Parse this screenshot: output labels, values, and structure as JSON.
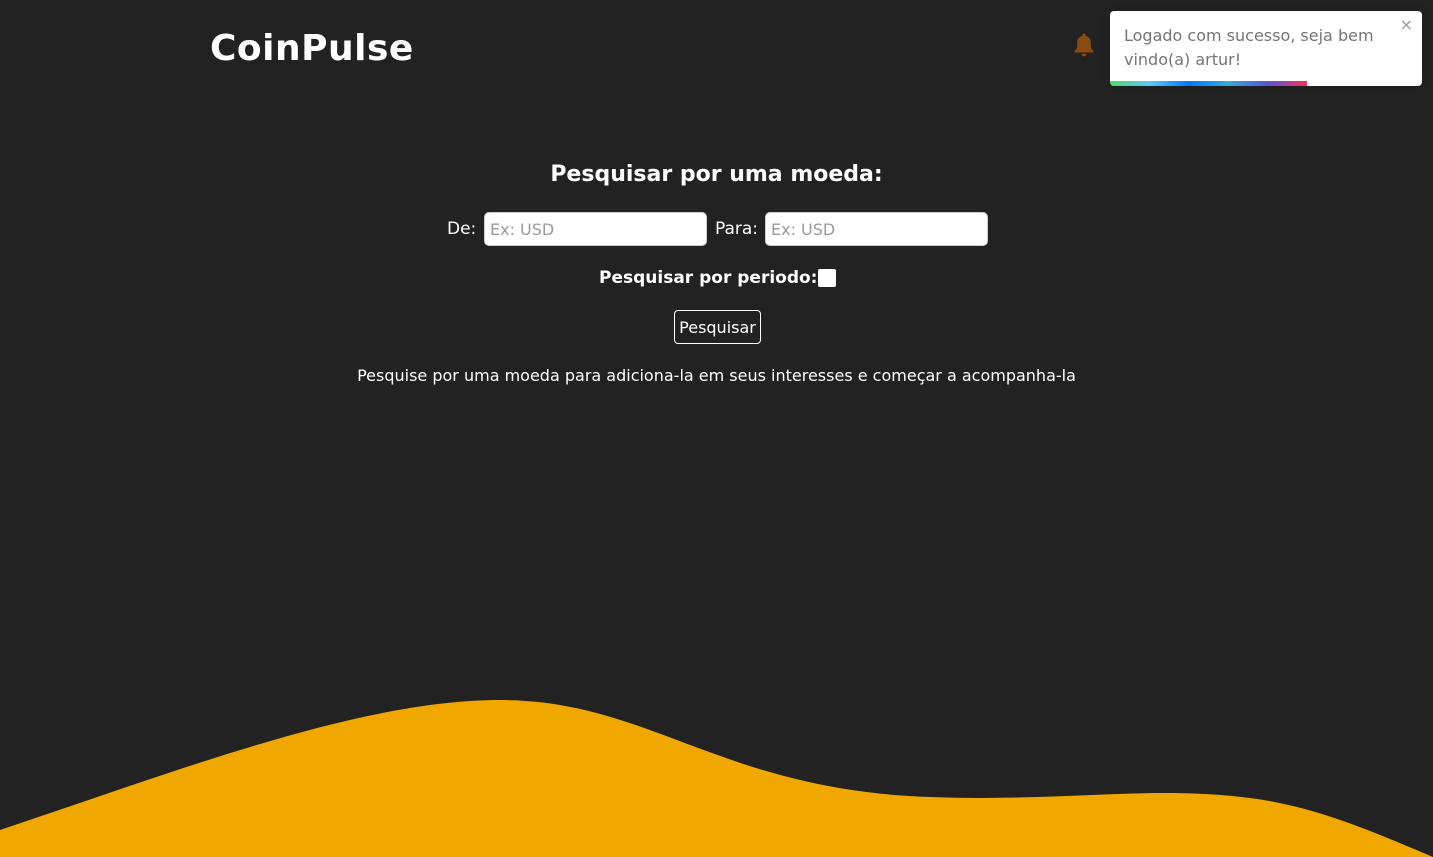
{
  "header": {
    "logo": "CoinPulse",
    "bell_icon": "bell-icon",
    "bell_color": "#8a4a12"
  },
  "toast": {
    "message": "Logado com sucesso, seja bem vindo(a) artur!",
    "close_label": "×",
    "close_icon": "close-icon",
    "progress": 0.63
  },
  "search": {
    "title": "Pesquisar por uma moeda:",
    "from_label": "De:",
    "from_placeholder": "Ex: USD",
    "to_label": "Para:",
    "to_placeholder": "Ex: USD",
    "period_label": "Pesquisar por periodo:",
    "period_checked": false,
    "button_label": "Pesquisar",
    "hint": "Pesquise por uma moeda para adiciona-la em seus interesses e começar a acompanha-la"
  },
  "colors": {
    "background": "#222222",
    "wave": "#f0a800",
    "text": "#ffffff"
  }
}
